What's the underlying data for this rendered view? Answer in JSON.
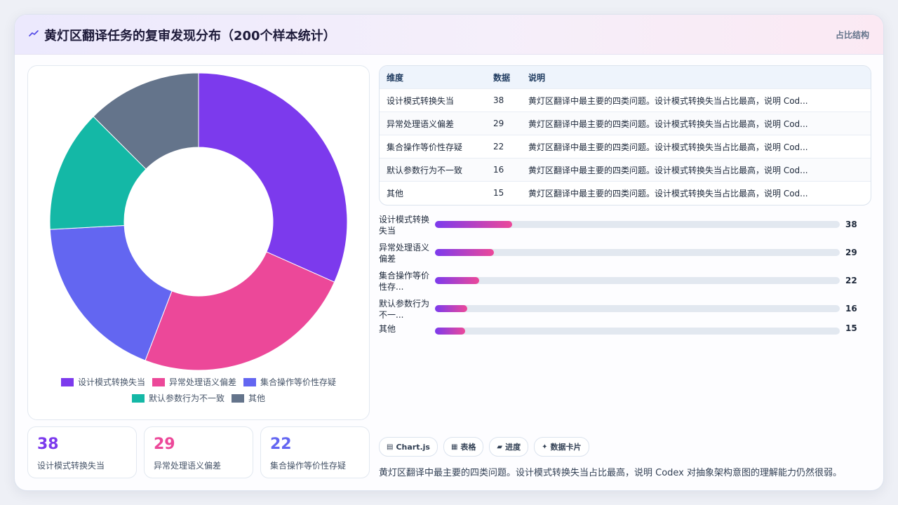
{
  "header": {
    "title": "黄灯区翻译任务的复审发现分布（200个样本统计）",
    "right_label": "占比结构",
    "icon": "sparkline-icon"
  },
  "colors": {
    "accent": "#7c3aed",
    "series": [
      "#7c3aed",
      "#ec4899",
      "#6366f1",
      "#14b8a6",
      "#64748b"
    ]
  },
  "chart_data": [
    {
      "type": "pie",
      "categories": [
        "设计模式转换失当",
        "异常处理语义偏差",
        "集合操作等价性存疑",
        "默认参数行为不一致",
        "其他"
      ],
      "values": [
        38,
        29,
        22,
        16,
        15
      ],
      "donut": true,
      "legend_position": "bottom"
    },
    {
      "type": "bar",
      "orientation": "horizontal",
      "categories": [
        "设计模式转换失当",
        "异常处理语义偏差",
        "集合操作等价性存疑",
        "默认参数行为不一致",
        "其他"
      ],
      "values": [
        38,
        29,
        22,
        16,
        15
      ],
      "xlim": [
        0,
        200
      ]
    }
  ],
  "table": {
    "headers": [
      "维度",
      "数据",
      "说明"
    ],
    "rows": [
      [
        "设计模式转换失当",
        "38",
        "黄灯区翻译中最主要的四类问题。设计模式转换失当占比最高，说明 Cod..."
      ],
      [
        "异常处理语义偏差",
        "29",
        "黄灯区翻译中最主要的四类问题。设计模式转换失当占比最高，说明 Cod..."
      ],
      [
        "集合操作等价性存疑",
        "22",
        "黄灯区翻译中最主要的四类问题。设计模式转换失当占比最高，说明 Cod..."
      ],
      [
        "默认参数行为不一致",
        "16",
        "黄灯区翻译中最主要的四类问题。设计模式转换失当占比最高，说明 Cod..."
      ],
      [
        "其他",
        "15",
        "黄灯区翻译中最主要的四类问题。设计模式转换失当占比最高，说明 Cod..."
      ]
    ]
  },
  "bars": {
    "rows": [
      {
        "label_line1": "设计模式转换",
        "label_line2": "失当",
        "value": "38"
      },
      {
        "label_line1": "异常处理语义",
        "label_line2": "偏差",
        "value": "29"
      },
      {
        "label_line1": "集合操作等价",
        "label_line2": "性存...",
        "value": "22"
      },
      {
        "label_line1": "默认参数行为",
        "label_line2": "不一...",
        "value": "16"
      },
      {
        "label_line1": "其他",
        "label_line2": "",
        "value": "15"
      }
    ]
  },
  "stats": [
    {
      "value": "38",
      "label": "设计模式转换失当",
      "color": "#7c3aed"
    },
    {
      "value": "29",
      "label": "异常处理语义偏差",
      "color": "#ec4899"
    },
    {
      "value": "22",
      "label": "集合操作等价性存疑",
      "color": "#6366f1"
    }
  ],
  "chips": [
    {
      "icon": "▤",
      "label": "Chart.js"
    },
    {
      "icon": "▦",
      "label": "表格"
    },
    {
      "icon": "▰",
      "label": "进度"
    },
    {
      "icon": "✦",
      "label": "数据卡片"
    }
  ],
  "summary": "黄灯区翻译中最主要的四类问题。设计模式转换失当占比最高，说明 Codex 对抽象架构意图的理解能力仍然很弱。"
}
